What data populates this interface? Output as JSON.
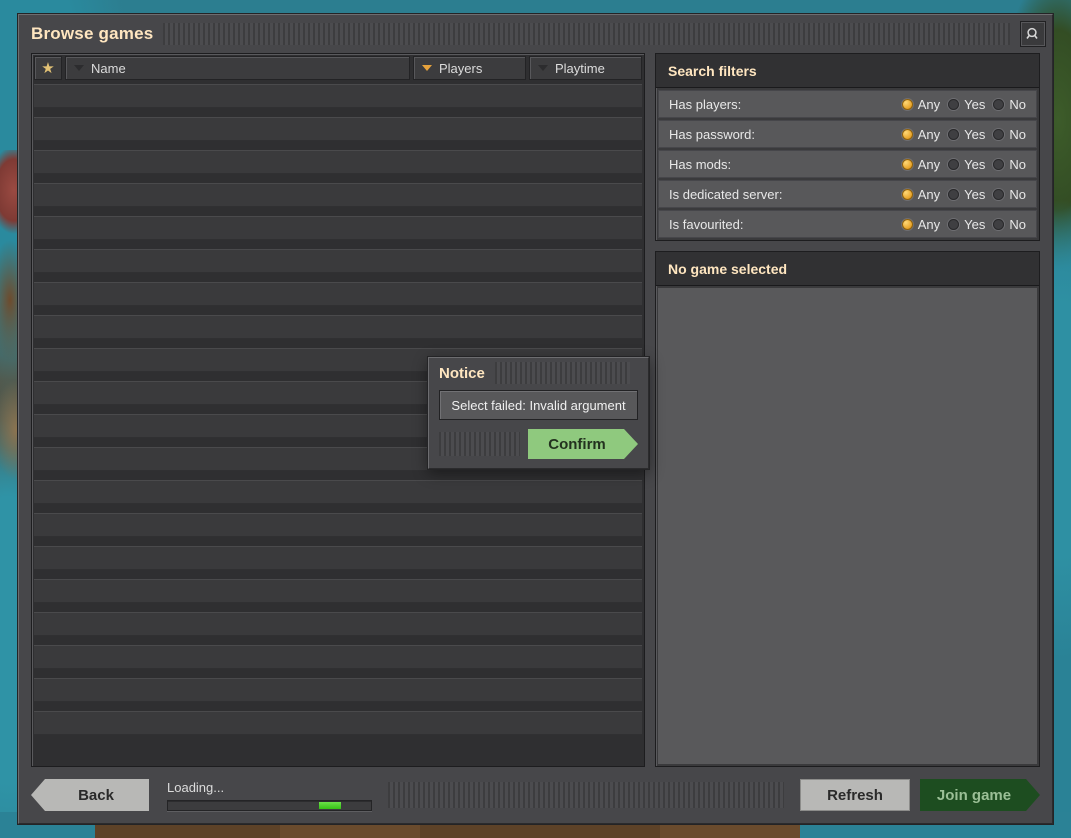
{
  "window": {
    "title": "Browse games",
    "search_icon": "search-icon"
  },
  "game_list": {
    "columns": [
      {
        "key": "favourite",
        "label": "",
        "icon": "star-icon",
        "sorted": false
      },
      {
        "key": "name",
        "label": "Name",
        "sorted": false
      },
      {
        "key": "players",
        "label": "Players",
        "sorted": true
      },
      {
        "key": "playtime",
        "label": "Playtime",
        "sorted": false
      }
    ],
    "rows": []
  },
  "search_filters": {
    "title": "Search filters",
    "options": [
      "Any",
      "Yes",
      "No"
    ],
    "rows": [
      {
        "label": "Has players:",
        "value": "Any"
      },
      {
        "label": "Has password:",
        "value": "Any"
      },
      {
        "label": "Has mods:",
        "value": "Any"
      },
      {
        "label": "Is dedicated server:",
        "value": "Any"
      },
      {
        "label": "Is favourited:",
        "value": "Any"
      }
    ]
  },
  "game_detail": {
    "title": "No game selected",
    "body": ""
  },
  "footer": {
    "back_label": "Back",
    "loading_label": "Loading...",
    "progress_percent": 85,
    "refresh_label": "Refresh",
    "join_label": "Join game"
  },
  "notice_dialog": {
    "title": "Notice",
    "message": "Select failed: Invalid argument",
    "confirm_label": "Confirm"
  },
  "colors": {
    "accent_gold": "#e6a23c",
    "title_text": "#ffe6c0",
    "confirm_green": "#8fc97e",
    "join_green": "#1d4d20",
    "progress_green": "#3ec81a",
    "star_gold": "#e3c275"
  }
}
